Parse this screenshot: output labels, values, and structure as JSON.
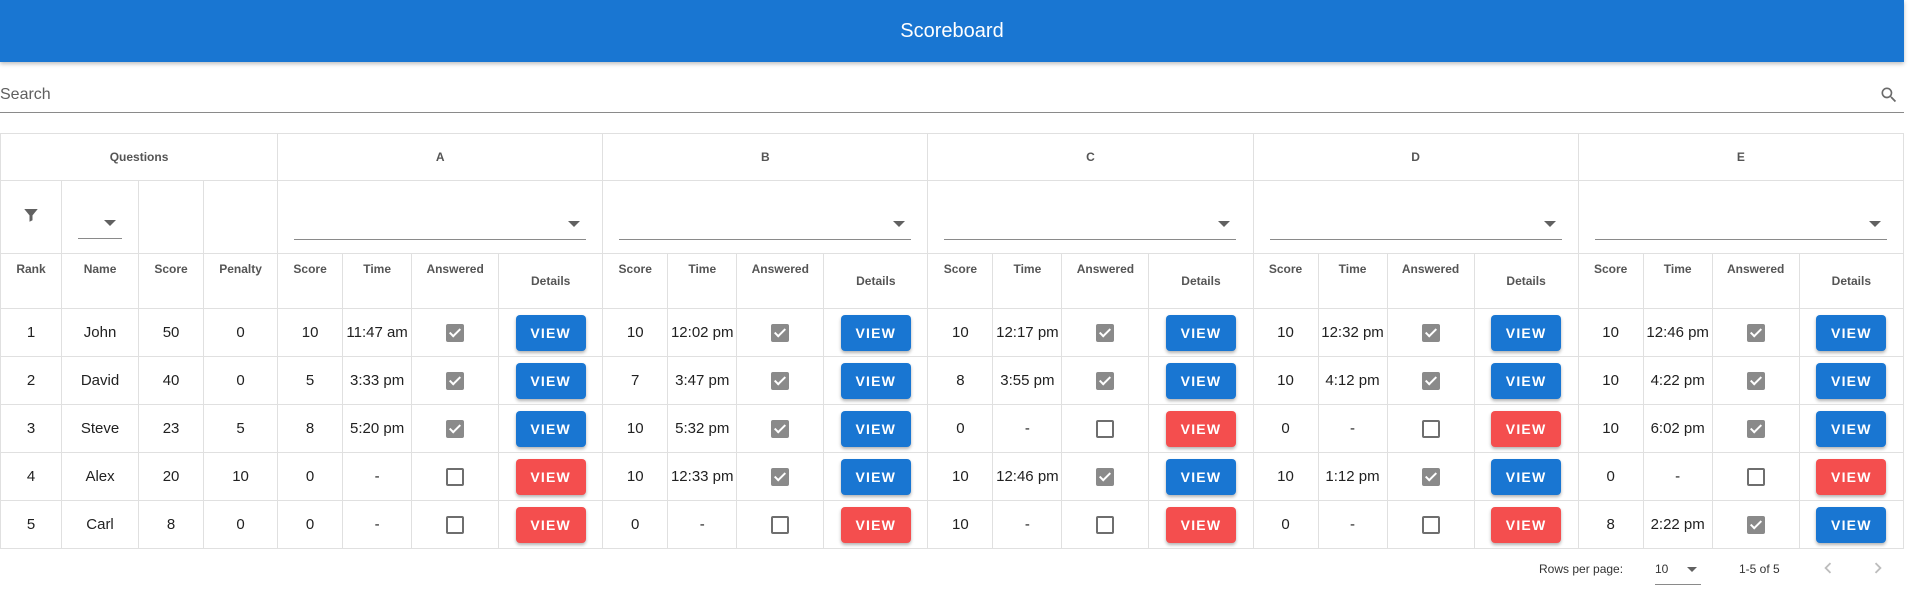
{
  "app": {
    "title": "Scoreboard"
  },
  "search": {
    "placeholder": "Search",
    "value": ""
  },
  "table": {
    "questions_label": "Questions",
    "question_groups": [
      "A",
      "B",
      "C",
      "D",
      "E"
    ],
    "headers": {
      "rank": "Rank",
      "name": "Name",
      "score": "Score",
      "penalty": "Penalty"
    },
    "sub_headers": {
      "score": "Score",
      "time": "Time",
      "answered": "Answered",
      "details": "Details"
    },
    "view_label": "VIEW",
    "rows": [
      {
        "rank": "1",
        "name": "John",
        "score": "50",
        "penalty": "0",
        "questions": [
          {
            "score": "10",
            "time": "11:47 am",
            "answered": true
          },
          {
            "score": "10",
            "time": "12:02 pm",
            "answered": true
          },
          {
            "score": "10",
            "time": "12:17 pm",
            "answered": true
          },
          {
            "score": "10",
            "time": "12:32 pm",
            "answered": true
          },
          {
            "score": "10",
            "time": "12:46 pm",
            "answered": true
          }
        ]
      },
      {
        "rank": "2",
        "name": "David",
        "score": "40",
        "penalty": "0",
        "questions": [
          {
            "score": "5",
            "time": "3:33 pm",
            "answered": true
          },
          {
            "score": "7",
            "time": "3:47 pm",
            "answered": true
          },
          {
            "score": "8",
            "time": "3:55 pm",
            "answered": true
          },
          {
            "score": "10",
            "time": "4:12 pm",
            "answered": true
          },
          {
            "score": "10",
            "time": "4:22 pm",
            "answered": true
          }
        ]
      },
      {
        "rank": "3",
        "name": "Steve",
        "score": "23",
        "penalty": "5",
        "questions": [
          {
            "score": "8",
            "time": "5:20 pm",
            "answered": true
          },
          {
            "score": "10",
            "time": "5:32 pm",
            "answered": true
          },
          {
            "score": "0",
            "time": "-",
            "answered": false
          },
          {
            "score": "0",
            "time": "-",
            "answered": false
          },
          {
            "score": "10",
            "time": "6:02 pm",
            "answered": true
          }
        ]
      },
      {
        "rank": "4",
        "name": "Alex",
        "score": "20",
        "penalty": "10",
        "questions": [
          {
            "score": "0",
            "time": "-",
            "answered": false
          },
          {
            "score": "10",
            "time": "12:33 pm",
            "answered": true
          },
          {
            "score": "10",
            "time": "12:46 pm",
            "answered": true
          },
          {
            "score": "10",
            "time": "1:12 pm",
            "answered": true
          },
          {
            "score": "0",
            "time": "-",
            "answered": false
          }
        ]
      },
      {
        "rank": "5",
        "name": "Carl",
        "score": "8",
        "penalty": "0",
        "questions": [
          {
            "score": "0",
            "time": "-",
            "answered": false
          },
          {
            "score": "0",
            "time": "-",
            "answered": false
          },
          {
            "score": "10",
            "time": "-",
            "answered": false
          },
          {
            "score": "0",
            "time": "-",
            "answered": false
          },
          {
            "score": "8",
            "time": "2:22 pm",
            "answered": true
          }
        ]
      }
    ]
  },
  "pagination": {
    "rows_per_page_label": "Rows per page:",
    "rows_per_page_value": "10",
    "range_text": "1-5 of 5"
  },
  "icons": {
    "search": "search-icon",
    "filter": "filter-icon",
    "dropdown": "arrow-drop-down-icon",
    "checkbox": "checkbox-icon",
    "prev": "chevron-left-icon",
    "next": "chevron-right-icon"
  },
  "colors": {
    "appbar": "#1976d2",
    "view_answered": "#1976d2",
    "view_unanswered": "#f44e4e",
    "checkbox_checked": "#8a8a8a"
  }
}
